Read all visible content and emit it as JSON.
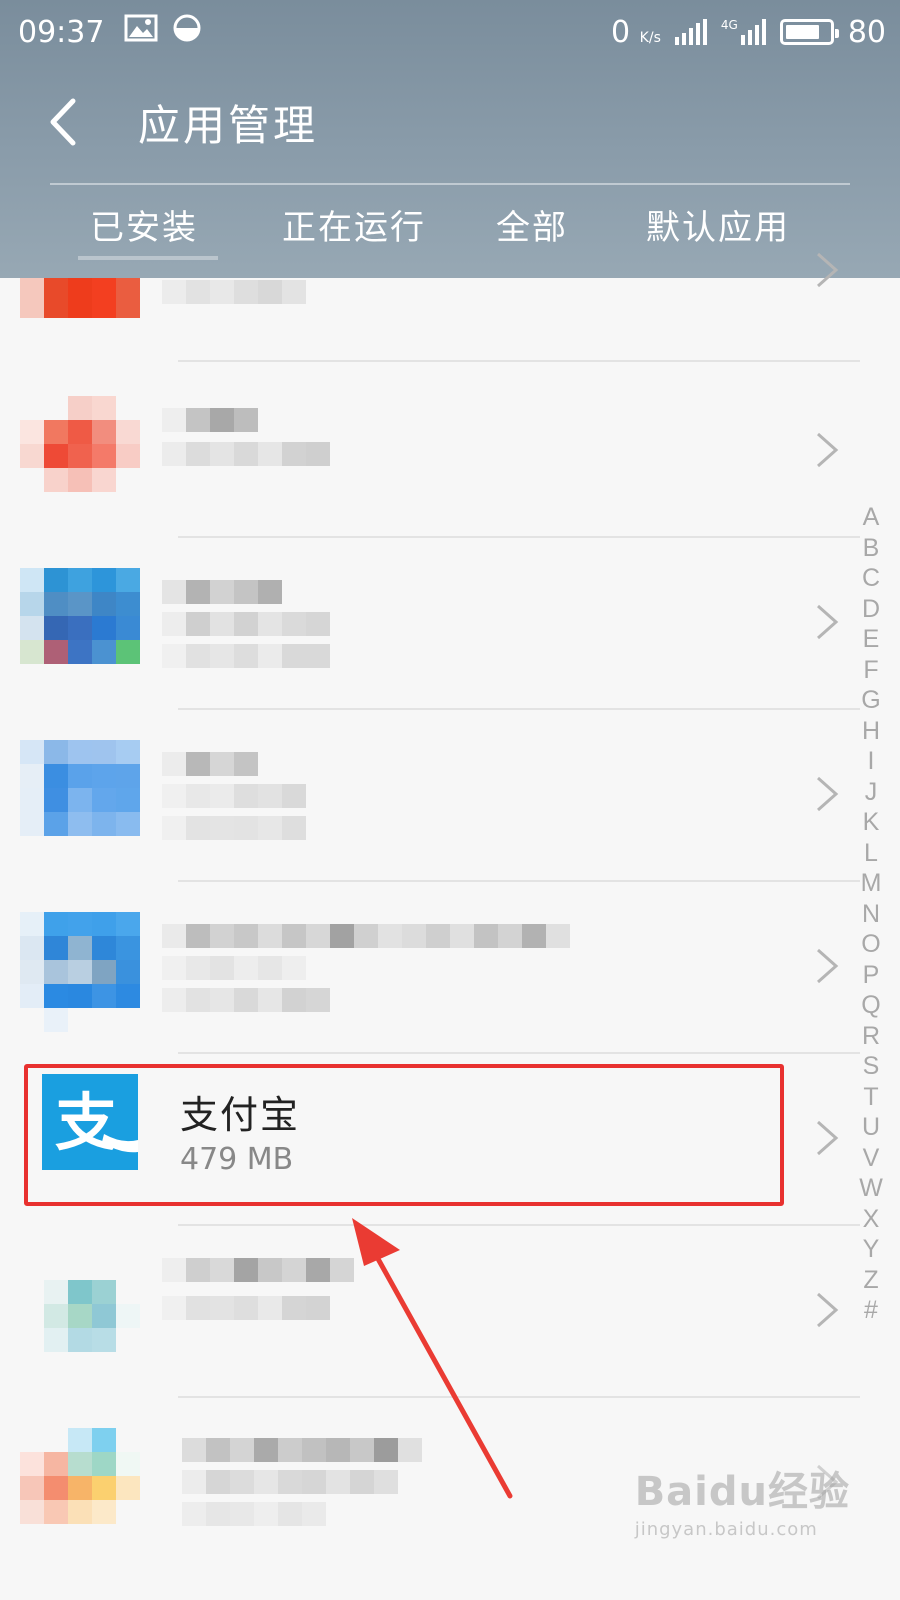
{
  "status_bar": {
    "time": "09:37",
    "net_speed": "0",
    "net_unit": "K/s",
    "net_type": "4G",
    "battery": "80",
    "icons": [
      "image-icon",
      "data-saver-icon",
      "signal-icon",
      "signal-4g-icon",
      "battery-icon"
    ]
  },
  "header": {
    "title": "应用管理",
    "back_icon": "chevron-left-icon"
  },
  "tabs": [
    {
      "label": "已安装"
    },
    {
      "label": "正在运行"
    },
    {
      "label": "全部"
    },
    {
      "label": "默认应用"
    }
  ],
  "highlighted_app": {
    "name": "支付宝",
    "size": "479 MB",
    "icon": "alipay-icon",
    "icon_color": "#1a9fe0",
    "highlight_color": "#e8312f"
  },
  "index_letters": [
    "A",
    "B",
    "C",
    "D",
    "E",
    "F",
    "G",
    "H",
    "I",
    "J",
    "K",
    "L",
    "M",
    "N",
    "O",
    "P",
    "Q",
    "R",
    "S",
    "T",
    "U",
    "V",
    "W",
    "X",
    "Y",
    "Z",
    "#"
  ],
  "watermark": {
    "brand": "Baidu经验",
    "url": "jingyan.baidu.com"
  }
}
